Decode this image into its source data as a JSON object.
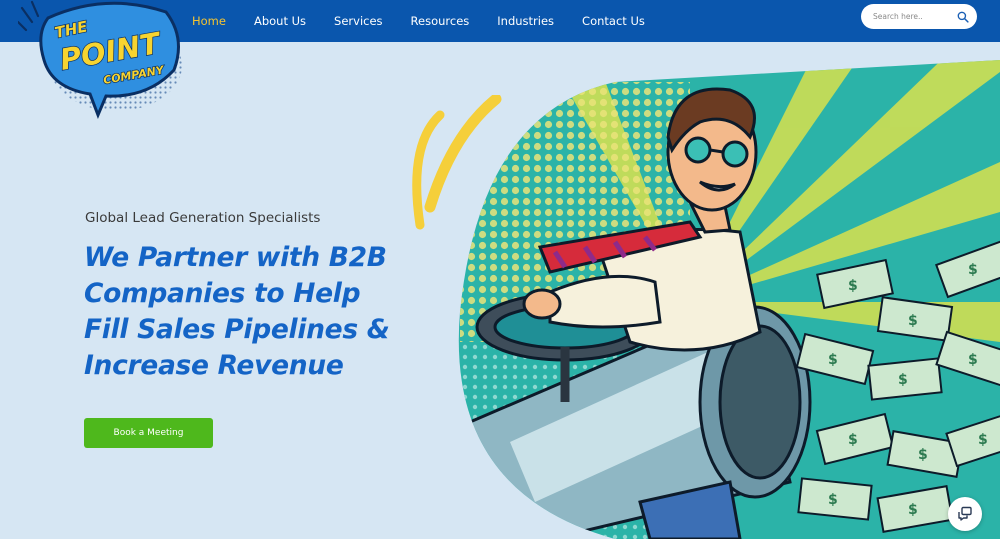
{
  "logo": {
    "line1": "THE",
    "line2": "POINT",
    "line3": "COMPANY"
  },
  "nav": {
    "items": [
      {
        "label": "Home",
        "active": true
      },
      {
        "label": "About Us",
        "active": false
      },
      {
        "label": "Services",
        "active": false
      },
      {
        "label": "Resources",
        "active": false
      },
      {
        "label": "Industries",
        "active": false
      },
      {
        "label": "Contact Us",
        "active": false
      }
    ]
  },
  "search": {
    "placeholder": "Search here..",
    "icon": "search-icon"
  },
  "hero": {
    "tagline": "Global Lead Generation Specialists",
    "headline": [
      "We Partner with B2B",
      "Companies to Help",
      "Fill Sales Pipelines &",
      "Increase Revenue"
    ],
    "cta_label": "Book a Meeting",
    "illustration": "pop-art man riding a money cannon"
  },
  "chat": {
    "icon": "chat-bubbles-icon"
  },
  "colors": {
    "nav_bg": "#0a56ad",
    "active_link": "#f5c431",
    "page_bg": "#d6e6f3",
    "headline": "#1464c6",
    "cta_bg": "#4eb81c"
  }
}
